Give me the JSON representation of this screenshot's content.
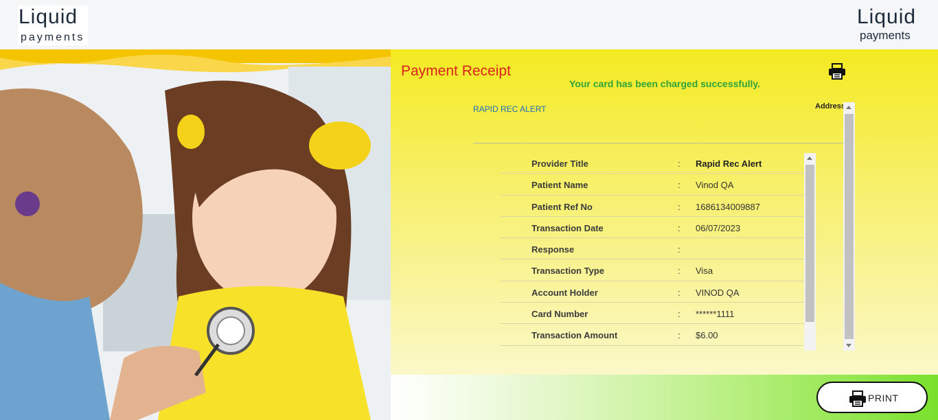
{
  "brand": {
    "left_logo_word": "Liquid",
    "left_logo_sub": "payments",
    "right_logo_word": "Liquid",
    "right_logo_sub": "payments"
  },
  "receipt": {
    "title": "Payment Receipt",
    "success_message": "Your card has been charged successfully.",
    "provider_name": "RAPID REC ALERT",
    "address_label": "Address",
    "rows": [
      {
        "label": "Provider Title",
        "value": "Rapid Rec Alert"
      },
      {
        "label": "Patient Name",
        "value": "Vinod QA"
      },
      {
        "label": "Patient Ref No",
        "value": "1686134009887"
      },
      {
        "label": "Transaction Date",
        "value": "06/07/2023"
      },
      {
        "label": "Response",
        "value": ""
      },
      {
        "label": "Transaction Type",
        "value": "Visa"
      },
      {
        "label": "Account Holder",
        "value": "VINOD QA"
      },
      {
        "label": "Card Number",
        "value": "******1111"
      },
      {
        "label": "Transaction Amount",
        "value": "$6.00"
      }
    ],
    "separator": ":"
  },
  "footer": {
    "print_label": "PRINT"
  },
  "icons": {
    "print": "printer-icon"
  },
  "colors": {
    "title_red": "#d8231f",
    "success_green": "#2fa33a",
    "link_blue": "#1d6fb8",
    "panel_yellow": "#f4ea22"
  }
}
